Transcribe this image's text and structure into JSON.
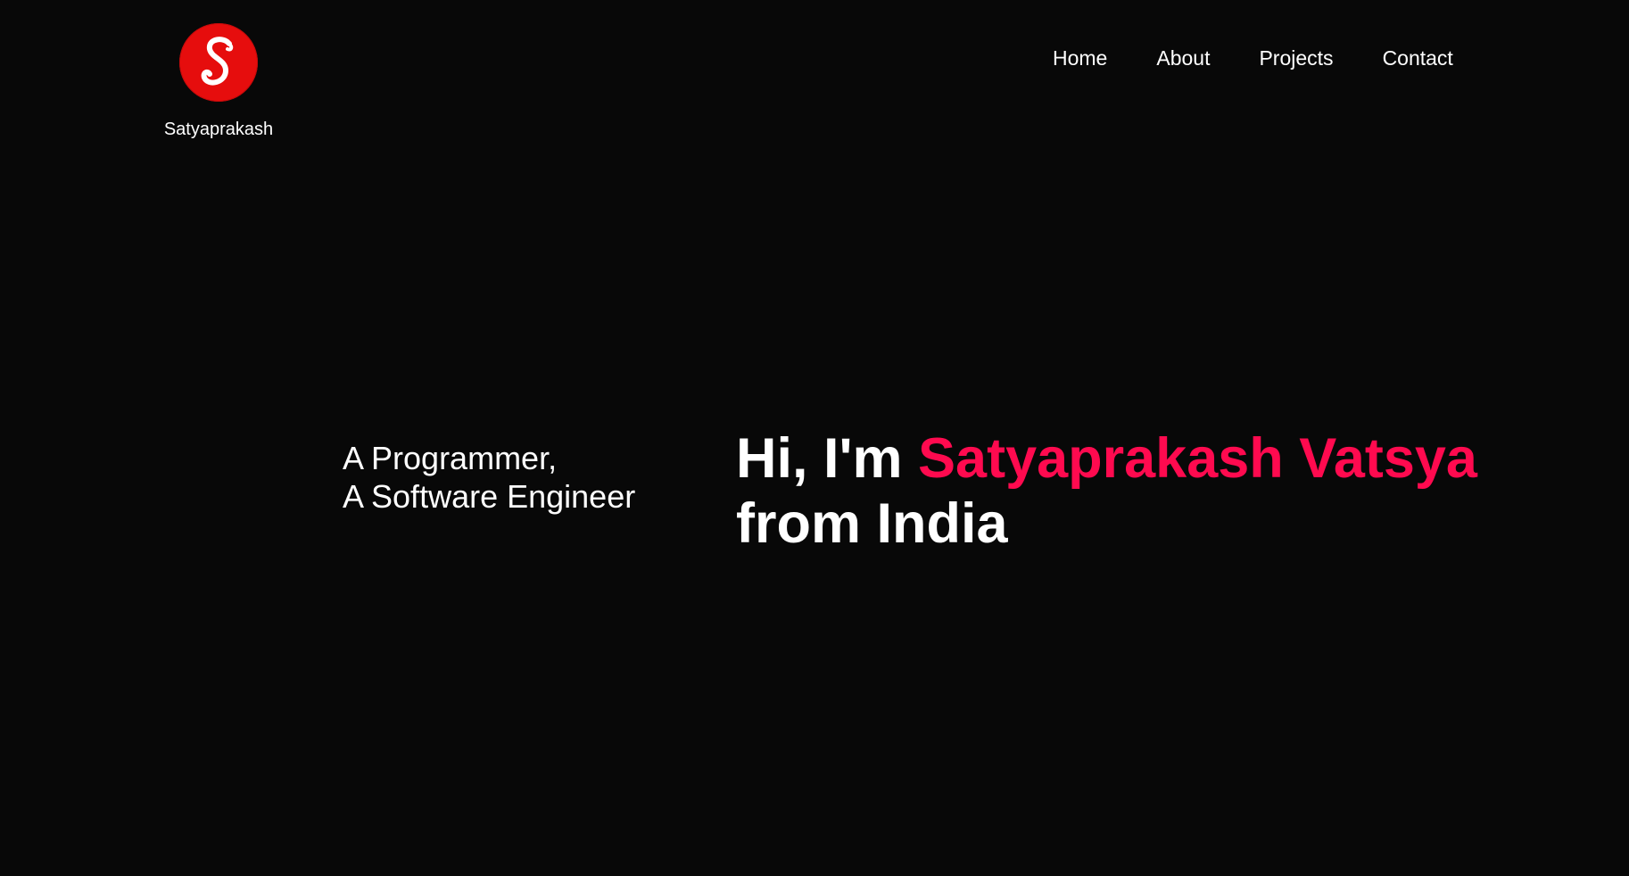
{
  "brand": {
    "logo_letter": "S",
    "name": "Satyaprakash",
    "logo_color": "#e60d0d"
  },
  "nav": {
    "items": [
      {
        "label": "Home"
      },
      {
        "label": "About"
      },
      {
        "label": "Projects"
      },
      {
        "label": "Contact"
      }
    ]
  },
  "hero": {
    "tagline_line1": "A Programmer,",
    "tagline_line2": "A Software Engineer",
    "greeting_prefix": "Hi, I'm",
    "highlight_name": "Satyaprakash Vatsya",
    "greeting_suffix": "from India",
    "accent_color": "#ff0a4f"
  },
  "theme": {
    "background": "#080808",
    "text": "#ffffff"
  }
}
